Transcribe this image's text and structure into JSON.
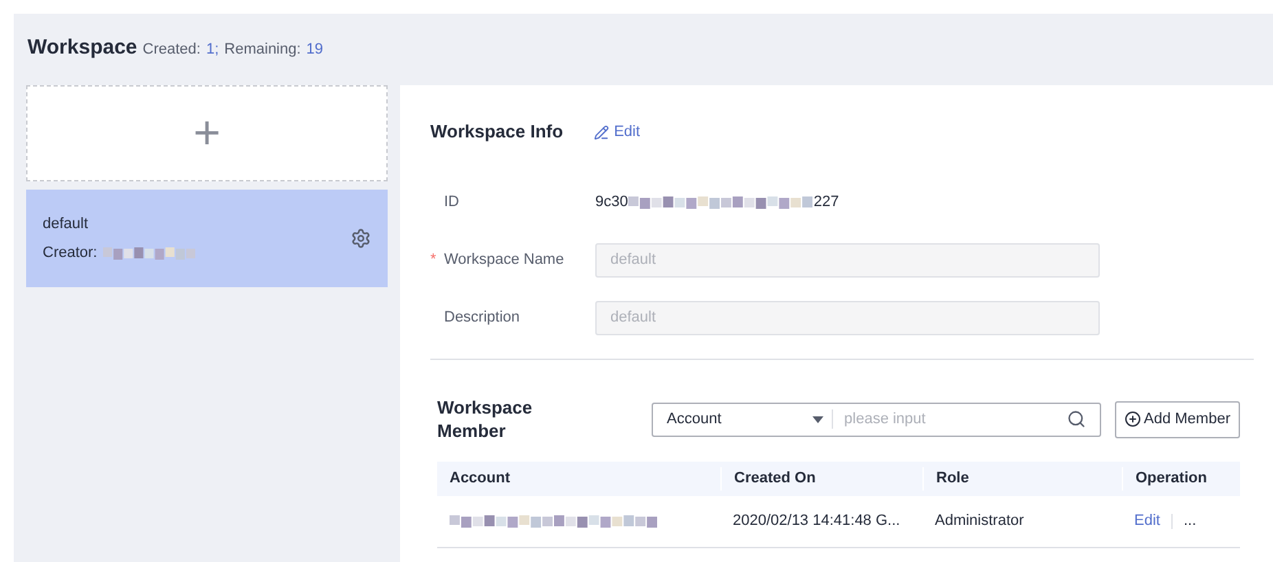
{
  "header": {
    "title": "Workspace",
    "created_label": "Created:",
    "created": "1;",
    "remaining_label": "Remaining:",
    "remaining": "19"
  },
  "add_card": {
    "icon": "+"
  },
  "workspaces": [
    {
      "name": "default",
      "creator_label": "Creator:",
      "selected": true
    }
  ],
  "info": {
    "title": "Workspace Info",
    "edit": "Edit",
    "required_mark": "*",
    "fields": [
      {
        "kind": "text",
        "label": "ID",
        "value_start": "9c30",
        "value_end": "227",
        "required": false
      },
      {
        "kind": "input",
        "label": "Workspace Name",
        "value": "default",
        "required": true
      },
      {
        "kind": "input",
        "label": "Description",
        "value": "default",
        "required": false
      }
    ]
  },
  "members": {
    "title": "Workspace Member",
    "filter": "Account",
    "search_placeholder": "please input",
    "add_button": "Add Member",
    "columns": [
      "Account",
      "Created On",
      "Role",
      "Operation"
    ],
    "rows": [
      {
        "created_on": "2020/02/13 14:41:48 G...",
        "role": "Administrator",
        "edit": "Edit",
        "more": "..."
      }
    ]
  }
}
